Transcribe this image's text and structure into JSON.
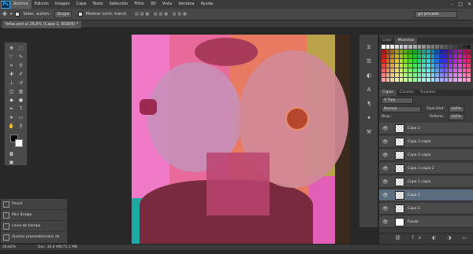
{
  "menubar": {
    "logo": "Ps",
    "items": [
      "Archivo",
      "Edición",
      "Imagen",
      "Capa",
      "Texto",
      "Selección",
      "Filtro",
      "3D",
      "Vista",
      "Ventana",
      "Ayuda"
    ],
    "active_index": 0
  },
  "options": {
    "sample_label": "Selec. autom.:",
    "sample_value": "Grupo",
    "show_transform": "Mostrar contr. transf.",
    "workspace": "gd privado"
  },
  "document": {
    "tab_label": "fefas.psd al 26,8% (Capa 1, RGB/8) *"
  },
  "panels": {
    "color_tabs": [
      "Color",
      "Muestras"
    ],
    "layers_tabs": [
      "Capas",
      "Canales",
      "Trazados"
    ],
    "kind_label": "Tipo",
    "blend_mode": "Normal",
    "opacity_label": "Opacidad:",
    "opacity_value": "100%",
    "lock_label": "Bloq.:",
    "fill_label": "Relleno:",
    "fill_value": "100%"
  },
  "layers": [
    {
      "name": "Capa 2",
      "selected": false
    },
    {
      "name": "Capa 3 copia",
      "selected": false
    },
    {
      "name": "Capa 2 copia",
      "selected": false
    },
    {
      "name": "Capa 3 copia 2",
      "selected": false
    },
    {
      "name": "Capa 1 copia",
      "selected": false
    },
    {
      "name": "Capa 1",
      "selected": true
    },
    {
      "name": "Capa 5",
      "selected": false
    },
    {
      "name": "Fondo",
      "selected": false
    }
  ],
  "mini_panels": [
    "Pincel",
    "Mini Bridge",
    "Línea de tiempo",
    "Ajustes preestablecidos de pin..."
  ],
  "status": {
    "zoom": "26,84%",
    "doc_size": "Doc: 36,0 MB/72,1 MB"
  },
  "colors": {
    "accent_selected": "#5d6d80",
    "canvas_pink": "#e25fb8"
  }
}
